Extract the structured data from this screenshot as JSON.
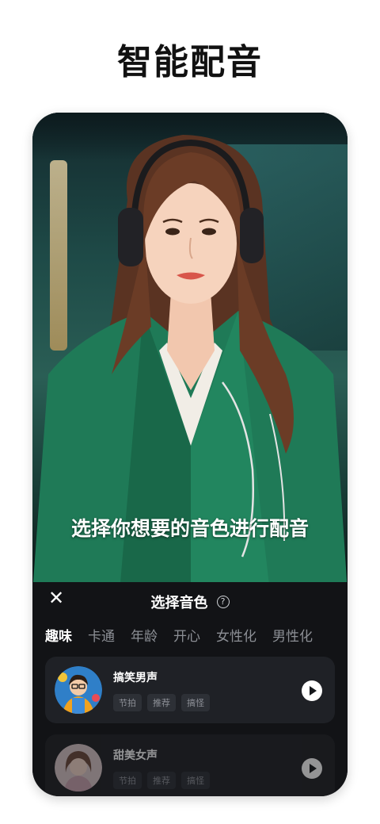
{
  "headline": "智能配音",
  "hero": {
    "caption": "选择你想要的音色进行配音"
  },
  "sheet": {
    "close_icon": "close-icon",
    "title": "选择音色",
    "help_icon": "help-circle-icon",
    "tabs": [
      {
        "label": "趣味",
        "active": true
      },
      {
        "label": "卡通",
        "active": false
      },
      {
        "label": "年龄",
        "active": false
      },
      {
        "label": "开心",
        "active": false
      },
      {
        "label": "女性化",
        "active": false
      },
      {
        "label": "男性化",
        "active": false
      }
    ],
    "voices": [
      {
        "name": "搞笑男声",
        "tags": [
          "节拍",
          "推荐",
          "搞怪"
        ],
        "play_icon": "play-icon"
      },
      {
        "name": "甜美女声",
        "tags": [
          "节拍",
          "推荐",
          "搞怪"
        ],
        "play_icon": "play-icon"
      }
    ]
  },
  "colors": {
    "sheet_bg": "#121316",
    "card_bg": "#1f2126",
    "blazer": "#1f7a57"
  }
}
